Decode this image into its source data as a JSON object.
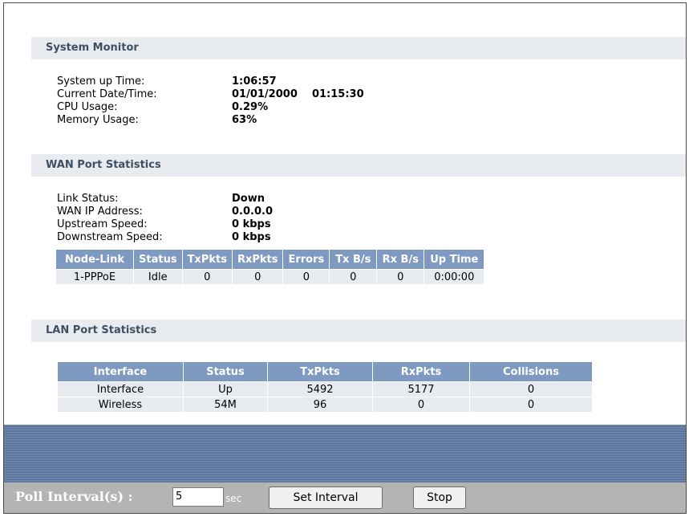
{
  "system_monitor": {
    "title": "System Monitor",
    "rows": [
      {
        "label": "System up Time:",
        "value": "1:06:57"
      },
      {
        "label": "Current Date/Time:",
        "value": "01/01/2000    01:15:30"
      },
      {
        "label": "CPU Usage:",
        "value": "0.29%"
      },
      {
        "label": "Memory Usage:",
        "value": "63%"
      }
    ]
  },
  "wan": {
    "title": "WAN Port Statistics",
    "rows": [
      {
        "label": "Link Status:",
        "value": "Down"
      },
      {
        "label": "WAN IP Address:",
        "value": "0.0.0.0"
      },
      {
        "label": "Upstream Speed:",
        "value": "0 kbps"
      },
      {
        "label": "Downstream Speed:",
        "value": "0 kbps"
      }
    ],
    "table": {
      "headers": [
        "Node-Link",
        "Status",
        "TxPkts",
        "RxPkts",
        "Errors",
        "Tx B/s",
        "Rx B/s",
        "Up Time"
      ],
      "rows": [
        [
          "1-PPPoE",
          "Idle",
          "0",
          "0",
          "0",
          "0",
          "0",
          "0:00:00"
        ]
      ]
    }
  },
  "lan": {
    "title": "LAN Port Statistics",
    "table": {
      "headers": [
        "Interface",
        "Status",
        "TxPkts",
        "RxPkts",
        "Collisions"
      ],
      "rows": [
        [
          "Interface",
          "Up",
          "5492",
          "5177",
          "0"
        ],
        [
          "Wireless",
          "54M",
          "96",
          "0",
          "0"
        ]
      ]
    }
  },
  "poll": {
    "label": "Poll Interval(s) :",
    "value": "5",
    "unit": "sec",
    "set_label": "Set Interval",
    "stop_label": "Stop"
  }
}
